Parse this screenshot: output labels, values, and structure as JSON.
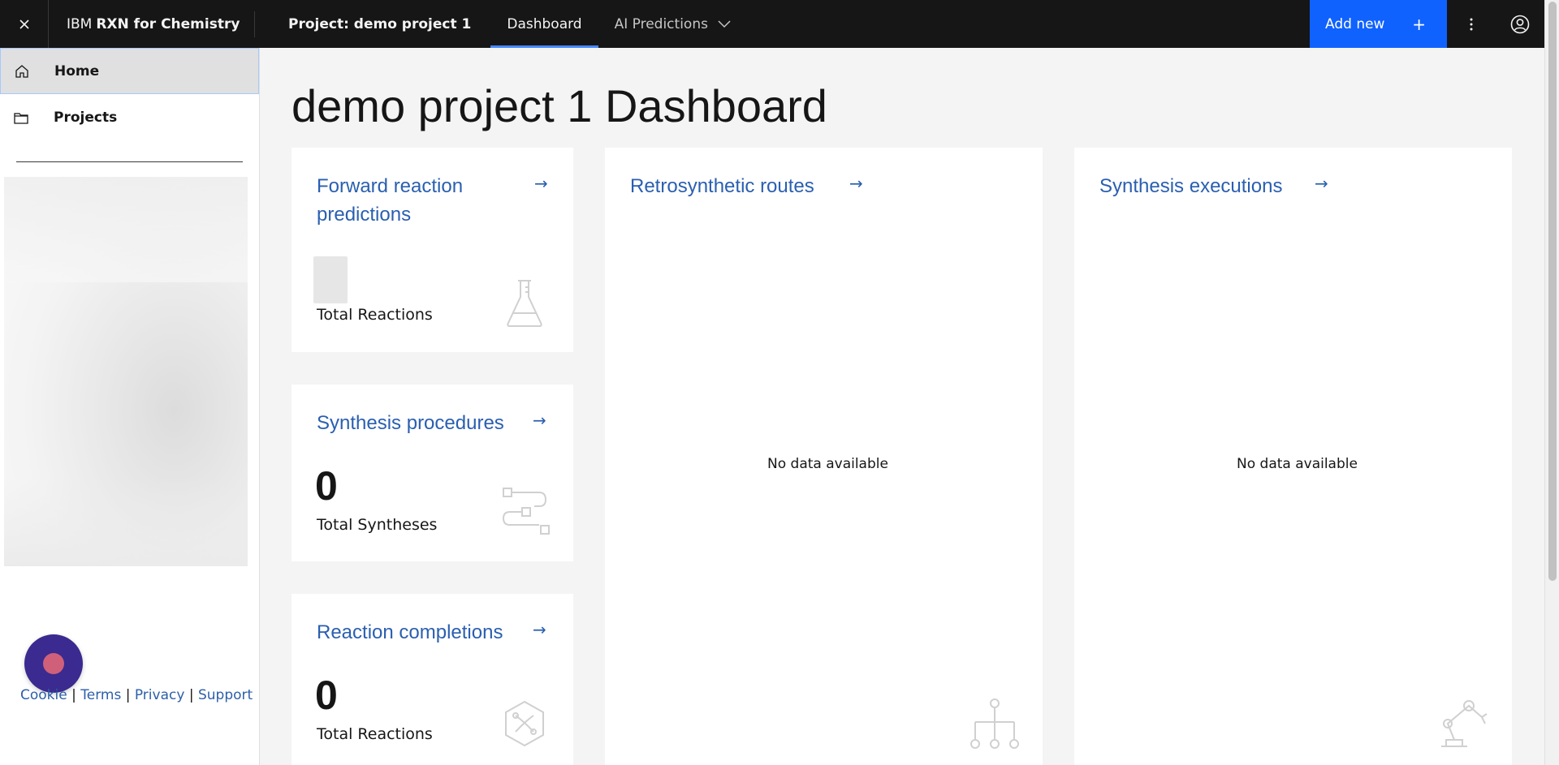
{
  "header": {
    "brand_prefix": "IBM",
    "brand_name": "RXN for Chemistry",
    "project_label": "Project: demo project 1",
    "nav": [
      {
        "label": "Dashboard",
        "active": true
      },
      {
        "label": "AI Predictions",
        "active": false
      }
    ],
    "add_new_label": "Add new",
    "add_new_icon": "+"
  },
  "sidebar": {
    "items": [
      {
        "label": "Home",
        "icon": "home-icon",
        "selected": true
      },
      {
        "label": "Projects",
        "icon": "folder-icon",
        "selected": false
      }
    ],
    "footer": {
      "cookie": "Cookie",
      "terms": "Terms",
      "privacy": "Privacy",
      "support": "Support",
      "separator": "|"
    }
  },
  "main": {
    "title": "demo project 1 Dashboard",
    "cards": {
      "forward": {
        "title": "Forward reaction predictions",
        "count_label": "Total Reactions"
      },
      "procedures": {
        "title": "Synthesis procedures",
        "count": "0",
        "count_label": "Total Syntheses"
      },
      "completions": {
        "title": "Reaction completions",
        "count": "0",
        "count_label": "Total Reactions"
      },
      "retro": {
        "title": "Retrosynthetic routes",
        "empty": "No data available"
      },
      "executions": {
        "title": "Synthesis executions",
        "empty": "No data available"
      }
    },
    "arrow": "→"
  },
  "colors": {
    "header_bg": "#161616",
    "accent": "#0f62fe",
    "link": "#2a5fb0",
    "chat_bubble": "#3b2a8f"
  }
}
